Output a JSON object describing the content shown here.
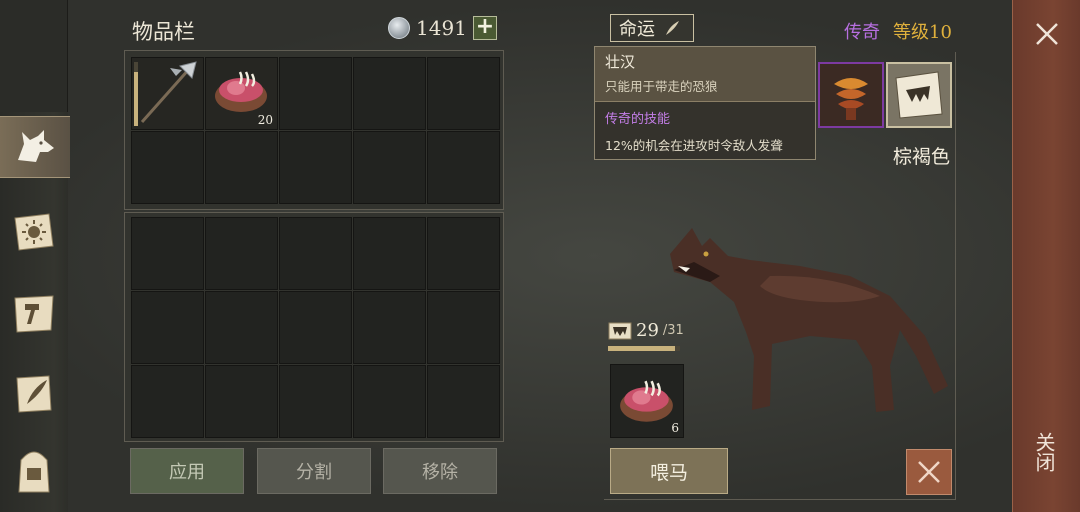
{
  "inventory": {
    "title": "物品栏",
    "currency_amount": "1491",
    "add_currency_label": "+",
    "items": [
      {
        "name": "halberd",
        "count": "",
        "durability": 0.85
      },
      {
        "name": "raw-meat",
        "count": "20"
      }
    ],
    "buttons": {
      "apply": "应用",
      "split": "分割",
      "remove": "移除"
    }
  },
  "pet": {
    "fate_tab": "命运",
    "rarity": "传奇",
    "level_label": "等级",
    "level_value": "10",
    "color": "棕褐色",
    "tooltip": {
      "title": "壮汉",
      "subtitle": "只能用于带走的恐狼",
      "section": "传奇的技能",
      "description": "12%的机会在进攻时令敌人发聋"
    },
    "food_current": "29",
    "food_max": "/31",
    "food_fraction": 0.935,
    "food_slot": {
      "name": "raw-meat",
      "count": "6"
    },
    "feed_button": "喂马"
  },
  "close_label": "关闭",
  "colors": {
    "legendary": "#b76fe0",
    "level": "#e0b13c",
    "close_bar": "#7a4432"
  },
  "icons": [
    "wolf-tab-icon",
    "sun-book-icon",
    "hammer-map-icon",
    "scroll-quill-icon",
    "backpack-icon"
  ]
}
